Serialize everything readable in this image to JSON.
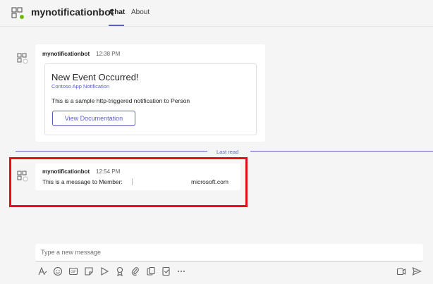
{
  "header": {
    "app_name": "mynotificationbot",
    "tabs": [
      {
        "label": "Chat",
        "active": true
      },
      {
        "label": "About",
        "active": false
      }
    ]
  },
  "messages": [
    {
      "sender": "mynotificationbot",
      "time": "12:38 PM",
      "card": {
        "title": "New Event Occurred!",
        "subtitle": "Contoso App Notification",
        "body": "This is a sample http-triggered notification to Person",
        "button_label": "View Documentation"
      }
    },
    {
      "sender": "mynotificationbot",
      "time": "12:54 PM",
      "text": "This is a message to Member:",
      "text_domain": "microsoft.com"
    }
  ],
  "last_read_label": "Last read",
  "composer": {
    "placeholder": "Type a new message"
  },
  "toolbar_icons": [
    "format-icon",
    "emoji-icon",
    "gif-icon",
    "sticker-icon",
    "meet-now-icon",
    "praise-icon",
    "attach-icon",
    "loop-icon",
    "more-icon"
  ],
  "colors": {
    "accent": "#5b5fc7",
    "highlight": "#e3101b",
    "background": "#f5f5f5"
  }
}
